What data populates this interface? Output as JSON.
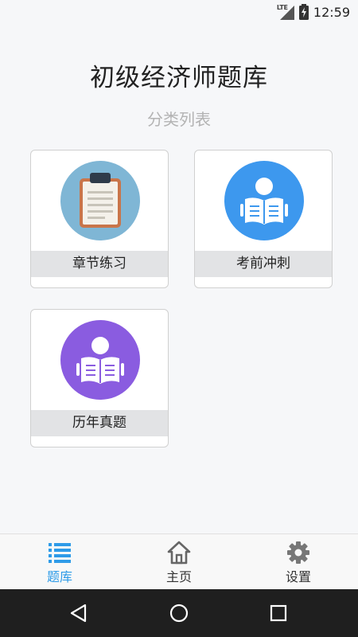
{
  "status_bar": {
    "network": "LTE",
    "time": "12:59"
  },
  "header": {
    "title": "初级经济师题库",
    "subtitle": "分类列表"
  },
  "categories": [
    {
      "label": "章节练习",
      "icon": "clipboard-icon",
      "color": "#7fb6d5"
    },
    {
      "label": "考前冲刺",
      "icon": "reading-person-icon",
      "color": "#3d98ee"
    },
    {
      "label": "历年真题",
      "icon": "reading-person-icon",
      "color": "#8a5ce0"
    }
  ],
  "bottom_nav": {
    "accent_color": "#2e9be8",
    "items": [
      {
        "label": "题库",
        "icon": "list-icon",
        "active": true
      },
      {
        "label": "主页",
        "icon": "home-icon",
        "active": false
      },
      {
        "label": "设置",
        "icon": "gear-icon",
        "active": false
      }
    ]
  },
  "system_nav": {
    "buttons": [
      "back-icon",
      "home-circle-icon",
      "recents-icon"
    ]
  }
}
